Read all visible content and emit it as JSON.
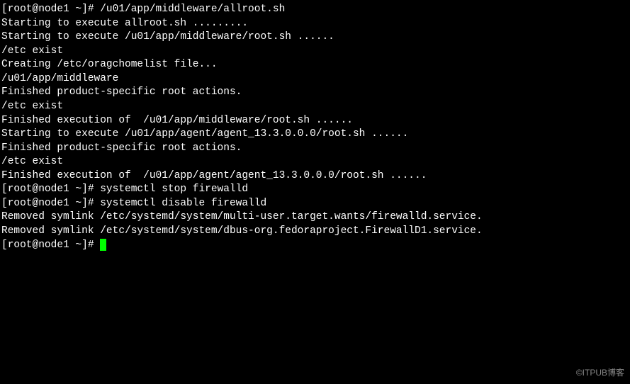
{
  "lines": {
    "l0": "[root@node1 ~]# /u01/app/middleware/allroot.sh",
    "l1": "",
    "l2": "Starting to execute allroot.sh .........",
    "l3": "",
    "l4": "Starting to execute /u01/app/middleware/root.sh ......",
    "l5": "/etc exist",
    "l6": "",
    "l7": "Creating /etc/oragchomelist file...",
    "l8": "/u01/app/middleware",
    "l9": "Finished product-specific root actions.",
    "l10": "/etc exist",
    "l11": "Finished execution of  /u01/app/middleware/root.sh ......",
    "l12": "",
    "l13": "",
    "l14": "Starting to execute /u01/app/agent/agent_13.3.0.0.0/root.sh ......",
    "l15": "Finished product-specific root actions.",
    "l16": "/etc exist",
    "l17": "Finished execution of  /u01/app/agent/agent_13.3.0.0.0/root.sh ......",
    "l18": "[root@node1 ~]# systemctl stop firewalld",
    "l19": "[root@node1 ~]# systemctl disable firewalld",
    "l20": "Removed symlink /etc/systemd/system/multi-user.target.wants/firewalld.service.",
    "l21": "Removed symlink /etc/systemd/system/dbus-org.fedoraproject.FirewallD1.service.",
    "l22": "[root@node1 ~]# "
  },
  "watermark": "©ITPUB博客"
}
